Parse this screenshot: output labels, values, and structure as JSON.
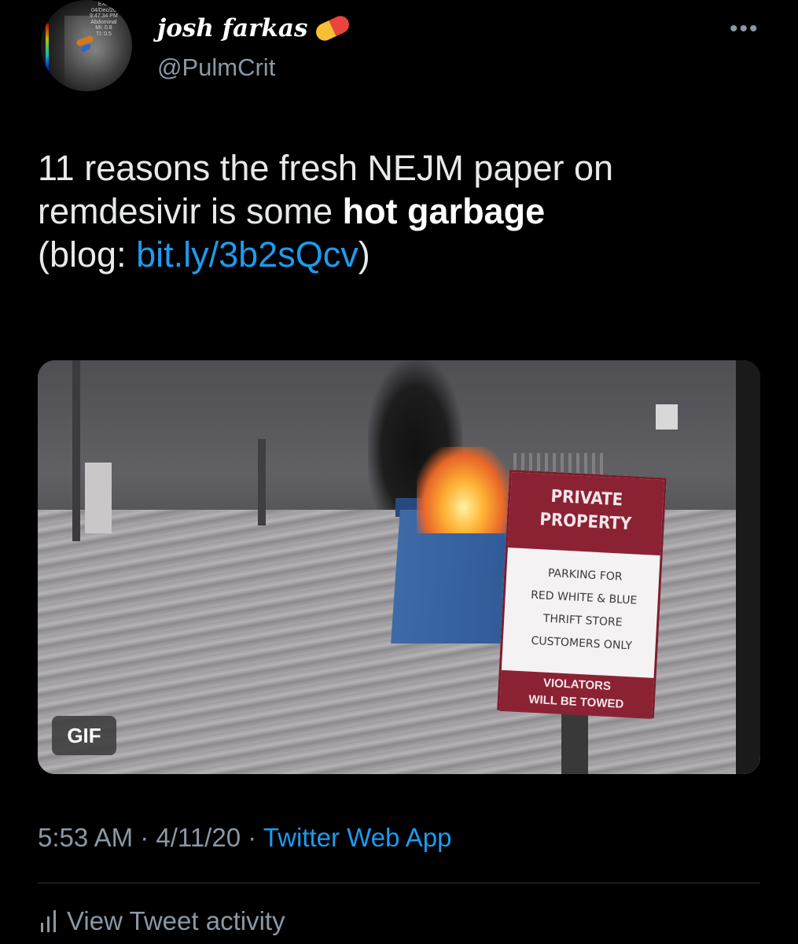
{
  "author": {
    "display_name": "josh farkas",
    "handle": "@PulmCrit",
    "badge_icon": "pill-icon",
    "avatar_overlay_text": [
      "EXA",
      "04/Dec/20",
      "9:47:34 PM",
      "Abdominal",
      "MI: 0.8",
      "TI: 0.5"
    ]
  },
  "tweet": {
    "text_line1": "11 reasons the fresh NEJM paper on",
    "text_line2_plain": "remdesivir is some ",
    "text_line2_bold": "hot garbage",
    "text_line3_prefix": "(blog: ",
    "text_line3_link": "bit.ly/3b2sQcv",
    "text_line3_suffix": ")"
  },
  "media": {
    "badge": "GIF",
    "sign": {
      "top_line1": "PRIVATE",
      "top_line2": "PROPERTY",
      "mid_lines": [
        "PARKING FOR",
        "RED WHITE & BLUE",
        "THRIFT STORE",
        "CUSTOMERS ONLY"
      ],
      "bottom_line1": "VIOLATORS",
      "bottom_line2": "WILL BE TOWED"
    }
  },
  "meta": {
    "time": "5:53 AM",
    "separator": " · ",
    "date": "4/11/20",
    "app": "Twitter Web App"
  },
  "activity": {
    "label": "View Tweet activity",
    "icon": "bar-chart-icon"
  },
  "menu": {
    "icon": "more-options-icon",
    "glyph": "•••"
  },
  "colors": {
    "background": "#000000",
    "link": "#1d9bf0",
    "secondary_text": "#8b98a5",
    "primary_text": "#e7e9ea"
  }
}
